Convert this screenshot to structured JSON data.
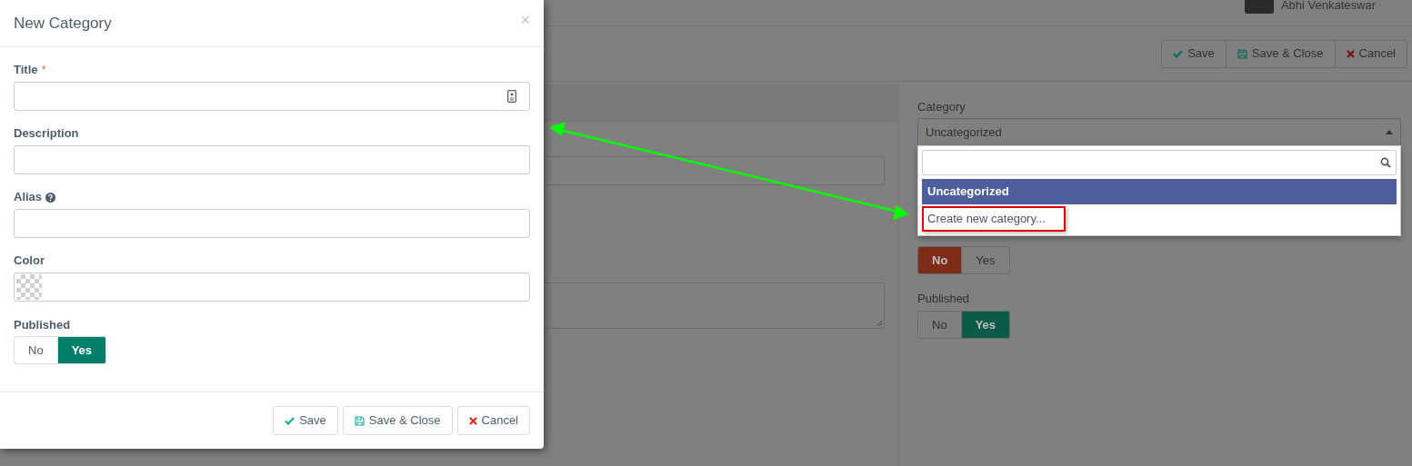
{
  "header": {
    "user_name": "Abhi Venkateswar"
  },
  "toolbar": {
    "buttons": [
      {
        "label": "Save",
        "kind": "save"
      },
      {
        "label": "Save & Close",
        "kind": "save_close"
      },
      {
        "label": "Cancel",
        "kind": "cancel"
      }
    ]
  },
  "sidebar": {
    "category": {
      "label": "Category",
      "value": "Uncategorized",
      "expanded": true,
      "options": [
        {
          "label": "Uncategorized",
          "selected": true,
          "highlighted": false
        },
        {
          "label": "Create new category...",
          "selected": false,
          "highlighted": true
        }
      ]
    },
    "preference_toggle": {
      "options": [
        {
          "label": "No",
          "selected": true
        },
        {
          "label": "Yes",
          "selected": false
        }
      ]
    },
    "published": {
      "label": "Published",
      "options": [
        {
          "label": "No",
          "selected": false
        },
        {
          "label": "Yes",
          "selected": true
        }
      ]
    }
  },
  "modal": {
    "title": "New Category",
    "close": "×",
    "fields": [
      {
        "label": "Title",
        "kind": "icon_input",
        "required": true,
        "help": false
      },
      {
        "label": "Description",
        "kind": "input",
        "required": false,
        "help": false
      },
      {
        "label": "Alias",
        "kind": "input",
        "required": false,
        "help": true
      },
      {
        "label": "Color",
        "kind": "color",
        "required": false,
        "help": false
      }
    ],
    "required_mark": "*",
    "published": {
      "label": "Published",
      "options": [
        {
          "label": "No",
          "selected": false
        },
        {
          "label": "Yes",
          "selected": true
        }
      ]
    },
    "buttons": [
      {
        "label": "Save",
        "kind": "save"
      },
      {
        "label": "Save & Close",
        "kind": "save_close"
      },
      {
        "label": "Cancel",
        "kind": "cancel"
      }
    ]
  }
}
